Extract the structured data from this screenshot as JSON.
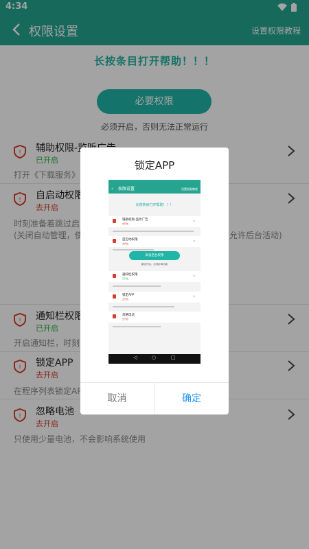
{
  "status_bar": {
    "time": "4:34",
    "wifi_icon": "wifi-icon",
    "battery_icon": "battery-icon"
  },
  "app_bar": {
    "title": "权限设置",
    "tutorial": "设置权限教程",
    "back_icon": "back-arrow-icon"
  },
  "help_text": "长按条目打开帮助！！！",
  "must_button": "必要权限",
  "must_subtitle": "必须开启，否则无法正常运行",
  "permissions": [
    {
      "name": "辅助权限-监听广告",
      "status": "已开启",
      "enabled": true,
      "desc": "打开《下载服务》中"
    },
    {
      "name": "自启动权限",
      "status": "去开启",
      "enabled": false,
      "desc": "时刻准备着跳过启动",
      "desc2": "(关闭自动管理，使",
      "desc2_tail": "允许后台活动)"
    },
    {
      "name": "通知栏权限",
      "status": "已开启",
      "enabled": true,
      "desc": "开启通知栏，时刻处"
    },
    {
      "name": "锁定APP",
      "status": "去开启",
      "enabled": false,
      "desc": "在程序列表锁定APP"
    },
    {
      "name": "忽略电池",
      "status": "去开启",
      "enabled": false,
      "desc": "只使用少量电池，不会影响系统使用"
    }
  ],
  "dialog": {
    "title": "锁定APP",
    "cancel": "取消",
    "confirm": "确定",
    "preview": {
      "title": "权限设置",
      "tutorial": "设置权限教程",
      "help": "长按条目打开帮助！！！",
      "button": "高省后台权限",
      "sub": "建议开启，否则影响功能",
      "rows": [
        {
          "name": "辅助权限-监听广告",
          "status": "去开启"
        },
        {
          "name": "自启动权限",
          "status": "去开启"
        },
        {
          "name": "通知栏权限",
          "status": "已开启"
        },
        {
          "name": "锁定APP",
          "status": "去开启"
        },
        {
          "name": "忽略电池",
          "status": "去开启"
        }
      ]
    }
  },
  "colors": {
    "primary": "#25a58f",
    "accent": "#20b5a6",
    "on": "#34b24a",
    "off": "#d63f2e",
    "confirm": "#2196f3"
  }
}
